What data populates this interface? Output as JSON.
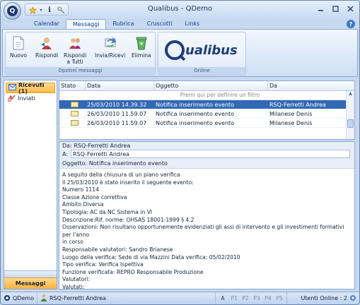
{
  "window": {
    "title": "Qualibus  -  QDemo"
  },
  "ribbon": {
    "tabs": [
      {
        "label": "Calendar"
      },
      {
        "label": "Messaggi"
      },
      {
        "label": "Rubrica"
      },
      {
        "label": "Cruscotti"
      },
      {
        "label": "Links"
      }
    ],
    "active_tab": "Messaggi",
    "groups": {
      "messages": {
        "label": "Opzioni messaggi",
        "buttons": [
          {
            "label": "Nuovo",
            "icon": "new-document-icon"
          },
          {
            "label": "Rispondi",
            "icon": "reply-icon"
          },
          {
            "label": "Rispondi\na Tutti",
            "icon": "reply-all-icon"
          },
          {
            "label": "Invia/Ricevi",
            "icon": "send-receive-icon"
          },
          {
            "label": "Elimina",
            "icon": "delete-icon"
          }
        ]
      },
      "online": {
        "label": "Online",
        "logo_text": "ualibus"
      }
    }
  },
  "nav": {
    "items": [
      {
        "label": "Ricevuti (1)",
        "icon": "inbox-icon"
      },
      {
        "label": "Inviati",
        "icon": "sent-icon"
      }
    ],
    "footer": "Messaggi"
  },
  "list": {
    "columns": [
      "Stato",
      "Data",
      "Oggetto",
      "Da"
    ],
    "filter_placeholder": "Premi qui per definire un filtro",
    "rows": [
      {
        "date": "25/03/2010 14.39.32",
        "subject": "Notifica inserimento evento",
        "from": "RSQ-Ferretti Andrea",
        "selected": true
      },
      {
        "date": "26/03/2010 11.59.07",
        "subject": "Notifica inserimento evento",
        "from": "Milanese Denis",
        "selected": false
      },
      {
        "date": "26/03/2010 11.59.07",
        "subject": "Notifica inserimento evento",
        "from": "Milanese Denis",
        "selected": false
      }
    ]
  },
  "preview": {
    "from_label": "Da:",
    "from": "RSQ-Ferretti Andrea",
    "to_label": "A:",
    "to": "RSQ-Ferretti Andrea",
    "subject_label": "Oggetto:",
    "subject": "Notifica inserimento evento",
    "body": "A seguito della chiusura di un piano verifica\nIl 25/03/2010 è stato inserito il seguente evento:\nNumero 1114\nClasse Azione correttiva\nAmbito Diversa\nTipologia: AC da NC Sistema in VI\nDescrizione:Rif. norme: OHSAS 18001-1999 § 4.2\nOsservazioni: Non risultano opportunemente evidenziati gli assi di intervento e gli investimenti formativi per l'anno\nin corso\nResponsabile valutatori: Sandro Brianese\nLuogo della verifica: Sede di via Mazzini Data verifica: 05/02/2010\nTipo verifica: Verifica Ispettiva\nFunzione verificata: REPRO Responsabile Produzione\nValutatori:\nValutati:"
  },
  "status": {
    "app": "QDemo",
    "user": "RSQ-Ferretti Andrea",
    "keys": [
      "A",
      "P1",
      "P2",
      "P3",
      "P4",
      "P5"
    ],
    "online": "Utenti Online : 2"
  }
}
